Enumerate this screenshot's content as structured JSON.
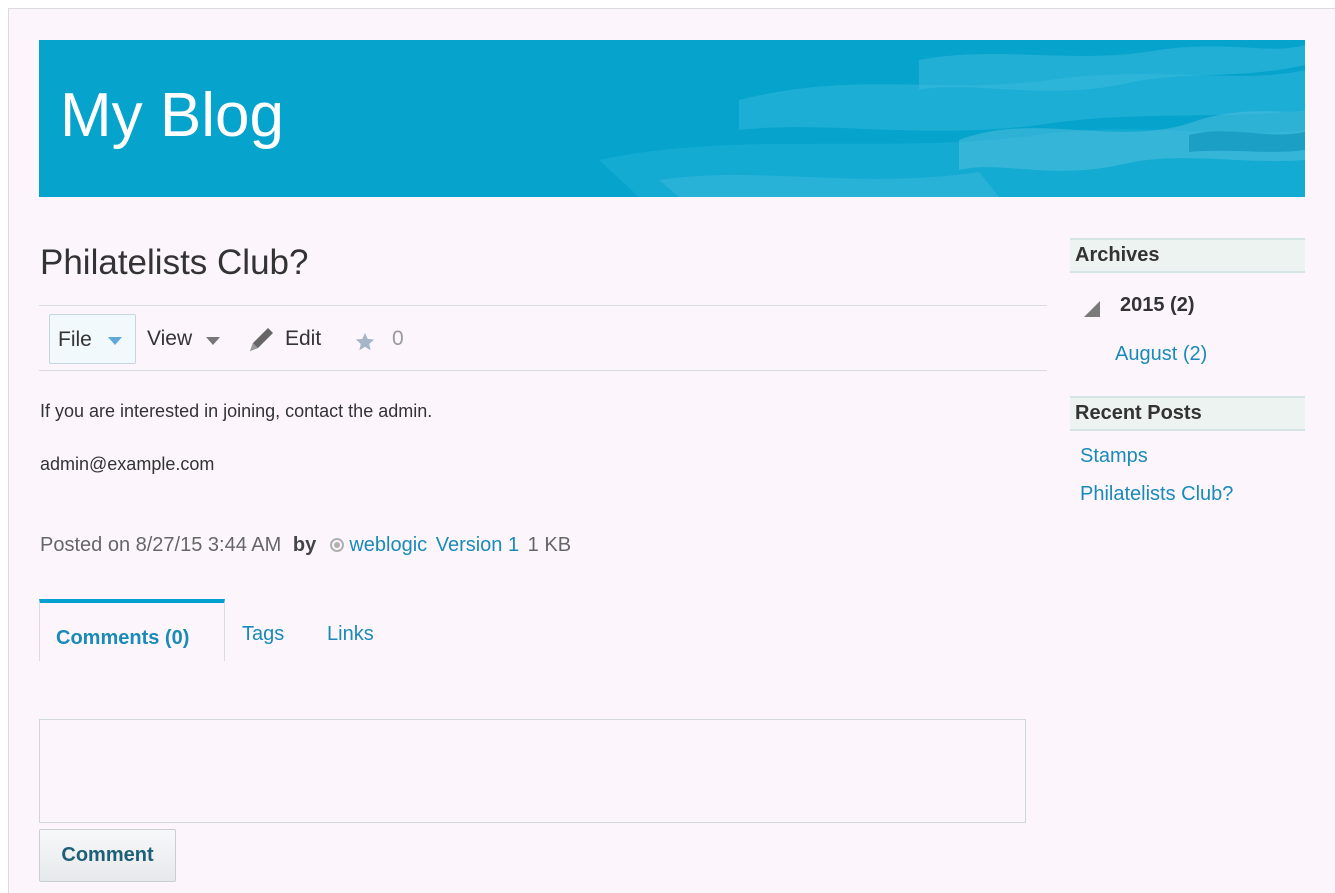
{
  "banner": {
    "title": "My Blog",
    "color": "#06a3cc"
  },
  "post": {
    "title": "Philatelists Club?",
    "toolbar": {
      "file_label": "File",
      "view_label": "View",
      "edit_label": "Edit",
      "rating_count": "0"
    },
    "body": [
      "If you are interested in joining, contact the admin.",
      "admin@example.com"
    ],
    "meta": {
      "posted_prefix": "Posted on 8/27/15 3:44 AM",
      "by_label": "by",
      "author": "weblogic",
      "version": "Version 1",
      "size": "1 KB"
    }
  },
  "tabs": [
    {
      "label": "Comments (0)",
      "active": true
    },
    {
      "label": "Tags",
      "active": false
    },
    {
      "label": "Links",
      "active": false
    }
  ],
  "comment": {
    "input_value": "",
    "button_label": "Comment"
  },
  "sidebar": {
    "archives": {
      "title": "Archives",
      "year": "2015 (2)",
      "month": "August (2)"
    },
    "recent": {
      "title": "Recent Posts",
      "items": [
        "Stamps",
        "Philatelists Club?"
      ]
    }
  },
  "icons": [
    "pencil-icon",
    "star-icon",
    "triangle-expanded-icon",
    "chevron-down-icon",
    "user-status-icon"
  ],
  "colors": {
    "accent": "#00a0d1",
    "link": "#1a8ab8",
    "page_bg": "#fcf6fc"
  }
}
